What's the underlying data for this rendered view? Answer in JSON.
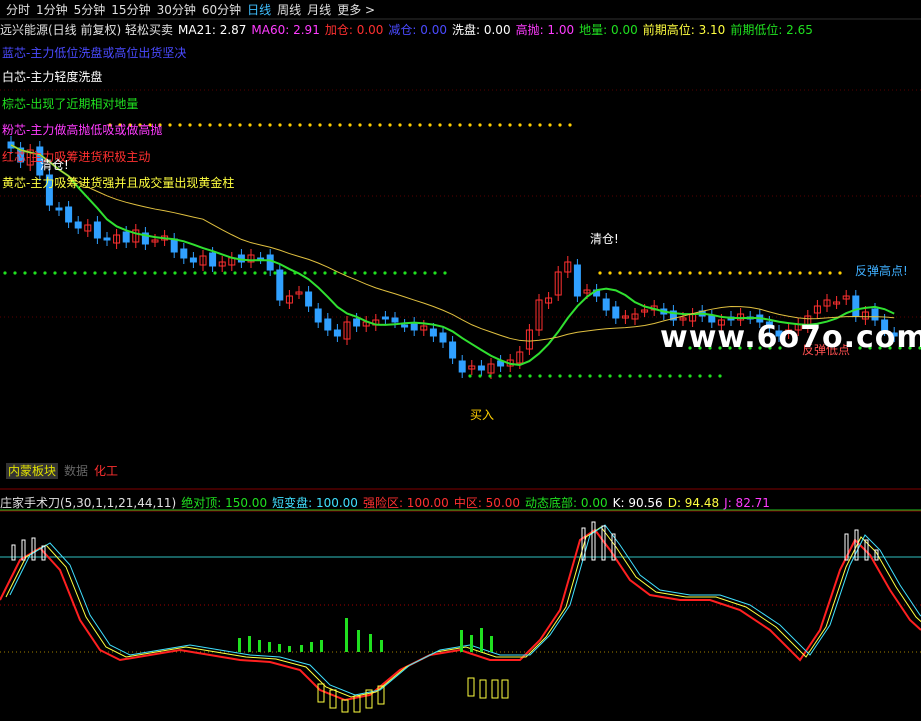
{
  "periods": [
    "分时",
    "1分钟",
    "5分钟",
    "15分钟",
    "30分钟",
    "60分钟",
    "日线",
    "周线",
    "月线",
    "更多 >"
  ],
  "active_period": "日线",
  "info": [
    {
      "t": "远兴能源(日线 前复权) 轻松买卖",
      "c": "#e0e0e0"
    },
    {
      "t": "MA21: 2.87",
      "c": "#ffffff"
    },
    {
      "t": "MA60: 2.91",
      "c": "#ff3cff"
    },
    {
      "t": "加仓: 0.00",
      "c": "#ff3030"
    },
    {
      "t": "减仓: 0.00",
      "c": "#4a4aff"
    },
    {
      "t": "洗盘: 0.00",
      "c": "#ffffff"
    },
    {
      "t": "高抛: 1.00",
      "c": "#ff3cff"
    },
    {
      "t": "地量: 0.00",
      "c": "#20e020"
    },
    {
      "t": "前期高位: 3.10",
      "c": "#ffff40"
    },
    {
      "t": "前期低位: 2.65",
      "c": "#20e020"
    }
  ],
  "legend": [
    {
      "t": "蓝芯-主力低位洗盘或高位出货坚决",
      "c": "#4a4aff"
    },
    {
      "t": "白芯-主力轻度洗盘",
      "c": "#ffffff"
    },
    {
      "t": "棕芯-出现了近期相对地量",
      "c": "#20e020"
    },
    {
      "t": "粉芯-主力做高抛低吸或做高抛",
      "c": "#ff3cff"
    },
    {
      "t": "红芯-主力吸筹进货积极主动",
      "c": "#ff3030"
    },
    {
      "t": "黄芯-主力吸筹进货强并且成交量出现黄金柱",
      "c": "#ffff40"
    }
  ],
  "annotations": {
    "qc1": "清仓!",
    "qc2": "清仓!",
    "buy": "买入",
    "bounce": "反弹高点!",
    "low": "反弹低点"
  },
  "watermark": "www.6o7o.com",
  "tabs": [
    "内蒙板块",
    "数据",
    "化工"
  ],
  "subinfo": [
    {
      "t": "庄家手术刀(5,30,1,1,21,44,11)",
      "c": "#e0e0e0"
    },
    {
      "t": "绝对顶: 150.00",
      "c": "#20e020"
    },
    {
      "t": "短变盘: 100.00",
      "c": "#40e0ff"
    },
    {
      "t": "强险区: 100.00",
      "c": "#ff3030"
    },
    {
      "t": "中区: 50.00",
      "c": "#ff3030"
    },
    {
      "t": "动态底部: 0.00",
      "c": "#20e020"
    },
    {
      "t": "K: 90.56",
      "c": "#ffffff"
    },
    {
      "t": "D: 94.48",
      "c": "#ffff40"
    },
    {
      "t": "J: 82.71",
      "c": "#ff3cff"
    }
  ],
  "colors": {
    "up": "#ff3030",
    "down": "#30a0ff",
    "ma21": "#30e030",
    "ma60": "#e0c040",
    "dotY": "#ffd000",
    "dotG": "#20e020"
  }
}
